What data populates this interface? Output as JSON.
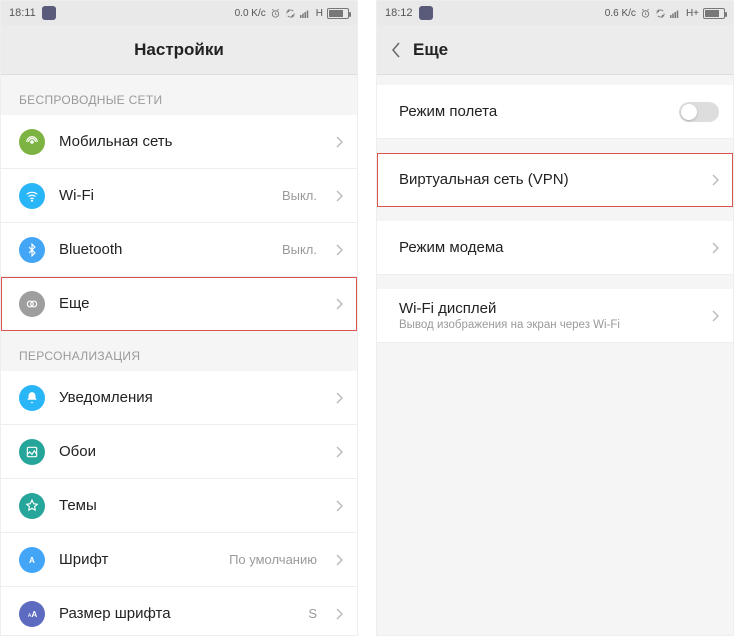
{
  "left": {
    "status": {
      "time": "18:11",
      "speed": "0.0 K/c",
      "net": "H"
    },
    "title": "Настройки",
    "sections": [
      {
        "header": "БЕСПРОВОДНЫЕ СЕТИ"
      },
      {
        "header": "ПЕРСОНАЛИЗАЦИЯ"
      }
    ],
    "wireless": {
      "mobile": "Мобильная сеть",
      "wifi": {
        "label": "Wi-Fi",
        "value": "Выкл."
      },
      "bluetooth": {
        "label": "Bluetooth",
        "value": "Выкл."
      },
      "more": "Еще"
    },
    "personal": {
      "notifications": "Уведомления",
      "wallpaper": "Обои",
      "themes": "Темы",
      "font": {
        "label": "Шрифт",
        "value": "По умолчанию"
      },
      "fontsize": {
        "label": "Размер шрифта",
        "value": "S"
      }
    }
  },
  "right": {
    "status": {
      "time": "18:12",
      "speed": "0.6 K/c",
      "net": "H+"
    },
    "title": "Еще",
    "items": {
      "airplane": "Режим полета",
      "vpn": "Виртуальная сеть (VPN)",
      "tether": "Режим модема",
      "wifidisplay": {
        "label": "Wi-Fi дисплей",
        "sub": "Вывод изображения на экран через Wi-Fi"
      }
    }
  },
  "colors": {
    "mobile": "#7cb342",
    "wifi": "#29b6f6",
    "bluetooth": "#42a5f5",
    "more": "#9e9e9e",
    "notifications": "#29b6f6",
    "wallpaper": "#26a69a",
    "themes": "#26a69a",
    "font": "#42a5f5",
    "fontsize": "#5c6bc0"
  }
}
